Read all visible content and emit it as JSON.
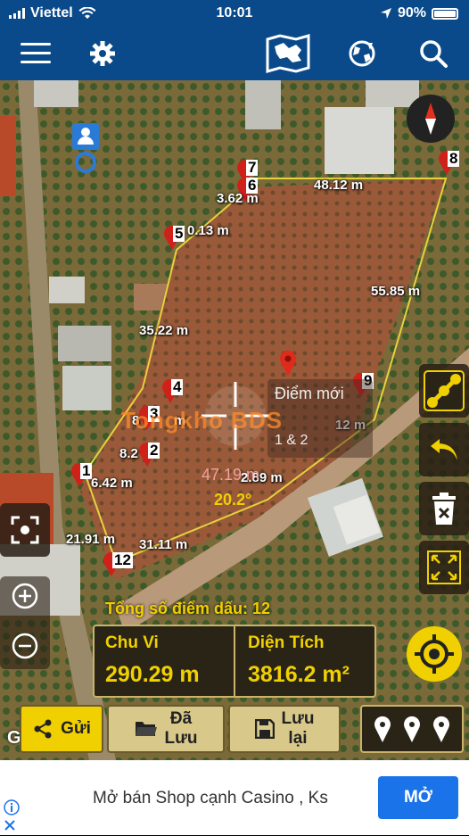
{
  "status": {
    "carrier": "Viettel",
    "time": "10:01",
    "battery": "90%"
  },
  "toolbar": {
    "icons": [
      "menu-icon",
      "gear-icon",
      "map-icon",
      "globe-icon",
      "search-icon"
    ]
  },
  "map": {
    "distances": [
      {
        "id": "d1",
        "text": "48.12 m"
      },
      {
        "id": "d2",
        "text": "3.62 m"
      },
      {
        "id": "d3",
        "text": "0.13 m"
      },
      {
        "id": "d4",
        "text": "55.85 m"
      },
      {
        "id": "d5",
        "text": "35.22 m"
      },
      {
        "id": "d6",
        "text": "8.2"
      },
      {
        "id": "d7",
        "text": "6.42 m"
      },
      {
        "id": "d8",
        "text": "21.91 m"
      },
      {
        "id": "d9",
        "text": "31.11 m"
      },
      {
        "id": "d10",
        "text": "2.89 m"
      },
      {
        "id": "d11",
        "text": "12 m"
      },
      {
        "id": "d12",
        "text": "8"
      },
      {
        "id": "d13",
        "text": "m"
      }
    ],
    "markers": [
      "1",
      "2",
      "3",
      "4",
      "5",
      "6",
      "7",
      "8",
      "9",
      "12"
    ],
    "new_point": {
      "line1": "Điểm mới",
      "line2": "1 & 2"
    },
    "measure": {
      "distance": "47.19 m",
      "angle": "20.2°"
    },
    "watermark": "Tongkho BDS",
    "google": "Google",
    "total_label": "Tổng số điểm dấu: 12"
  },
  "panel": {
    "perimeter_label": "Chu Vi",
    "perimeter_value": "290.29 m",
    "area_label": "Diện Tích",
    "area_value": "3816.2 m²"
  },
  "buttons": {
    "send": "Gửi",
    "saved_1": "Đã",
    "saved_2": "Lưu",
    "save_1": "Lưu",
    "save_2": "lại"
  },
  "ad": {
    "text": "Mở bán Shop cạnh Casino , Ks",
    "cta": "MỞ"
  },
  "colors": {
    "toolbar": "#0a4a8a",
    "boundary": "#e6d23c",
    "accent": "#f0d000"
  }
}
